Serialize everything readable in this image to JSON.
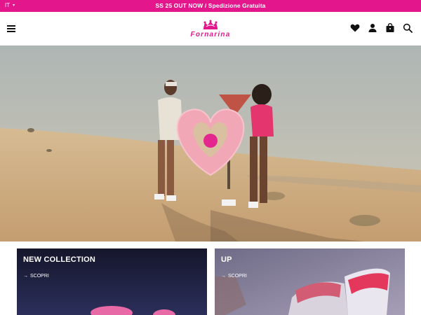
{
  "topbar": {
    "language": "IT",
    "language_chevron": "chevron-down-icon",
    "promo_text": "SS 25 OUT NOW / Spedizione Gratuita",
    "background": "#e4168c"
  },
  "header": {
    "logo_text": "Fornarina",
    "icons": [
      "menu-icon",
      "heart-icon",
      "user-icon",
      "bag-icon",
      "search-icon"
    ]
  },
  "hero": {
    "image": "desert-beach-campaign-photo"
  },
  "cards": [
    {
      "title": "NEW COLLECTION",
      "link_arrow": "→",
      "link_label": "SCOPRI"
    },
    {
      "title": "UP",
      "link_arrow": "→",
      "link_label": "SCOPRI"
    }
  ],
  "colors": {
    "brand_pink": "#e4168c"
  }
}
